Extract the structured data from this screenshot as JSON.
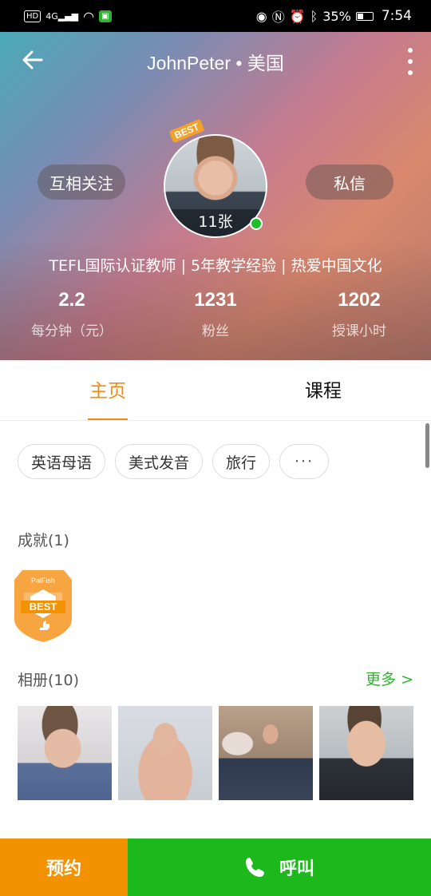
{
  "status_bar": {
    "left_chips": [
      "HD",
      "4G"
    ],
    "right_battery": "35%",
    "time": "7:54",
    "icons": [
      "eye-icon",
      "nfc-icon",
      "alarm-icon",
      "bluetooth-icon",
      "battery-icon"
    ]
  },
  "header": {
    "title": "JohnPeter • 美国",
    "follow_label": "互相关注",
    "message_label": "私信",
    "avatar_badge": "BEST",
    "avatar_count": "11张",
    "bio": "TEFL国际认证教师 | 5年教学经验 | 热爱中国文化",
    "stats": [
      {
        "value": "2.2",
        "label": "每分钟（元）"
      },
      {
        "value": "1231",
        "label": "粉丝"
      },
      {
        "value": "1202",
        "label": "授课小时"
      }
    ]
  },
  "tabs": [
    {
      "label": "主页",
      "active": true
    },
    {
      "label": "课程",
      "active": false
    }
  ],
  "tags": [
    "英语母语",
    "美式发音",
    "旅行",
    "···"
  ],
  "achievements": {
    "title": "成就(1)",
    "badge_brand": "PalFish",
    "badge_text": "BEST"
  },
  "album": {
    "title": "相册(10)",
    "more_label": "更多 >"
  },
  "bottom": {
    "book_label": "预约",
    "call_label": "呼叫"
  },
  "colors": {
    "accent": "#f08a10",
    "green": "#1cb81c",
    "orange": "#f39200"
  }
}
